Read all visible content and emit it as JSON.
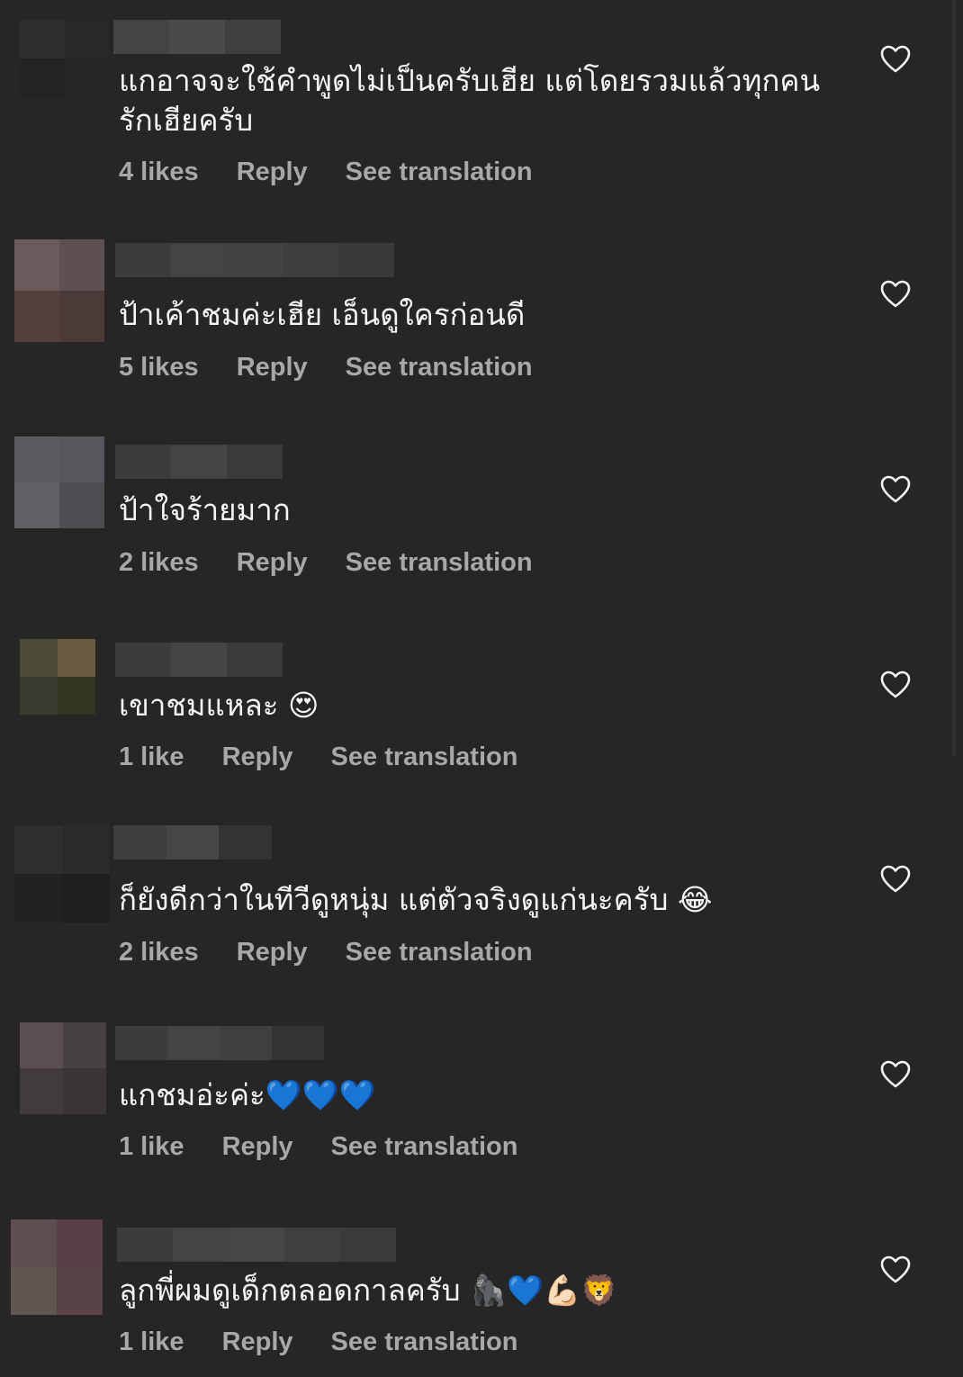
{
  "comments": [
    {
      "text": "แกอาจจะใช้คำพูดไม่เป็นครับเฮีย แต่โดยรวมแล้วทุกคน\nรักเฮียครับ",
      "likes": "4 likes",
      "reply": "Reply",
      "translate": "See translation"
    },
    {
      "text": "ป้าเค้าชมค่ะเฮีย เอ็นดูใครก่อนดี",
      "likes": "5 likes",
      "reply": "Reply",
      "translate": "See translation"
    },
    {
      "text": "ป้าใจร้ายมาก",
      "likes": "2 likes",
      "reply": "Reply",
      "translate": "See translation"
    },
    {
      "text": "เขาชมแหละ 😍",
      "likes": "1 like",
      "reply": "Reply",
      "translate": "See translation"
    },
    {
      "text": "ก็ยังดีกว่าในทีวีดูหนุ่ม แต่ตัวจริงดูแก่นะครับ 😂",
      "likes": "2 likes",
      "reply": "Reply",
      "translate": "See translation"
    },
    {
      "text": "แกชมอ่ะค่ะ💙💙💙",
      "likes": "1 like",
      "reply": "Reply",
      "translate": "See translation"
    },
    {
      "text": "ลูกพี่ผมดูเด็กตลอดกาลครับ 🦍💙💪🏻🦁",
      "likes": "1 like",
      "reply": "Reply",
      "translate": "See translation"
    }
  ],
  "icons": {
    "like": "heart-outline-icon"
  },
  "colors": {
    "background": "#262626",
    "text": "#f5f5f5",
    "meta": "#a8a8a8"
  }
}
